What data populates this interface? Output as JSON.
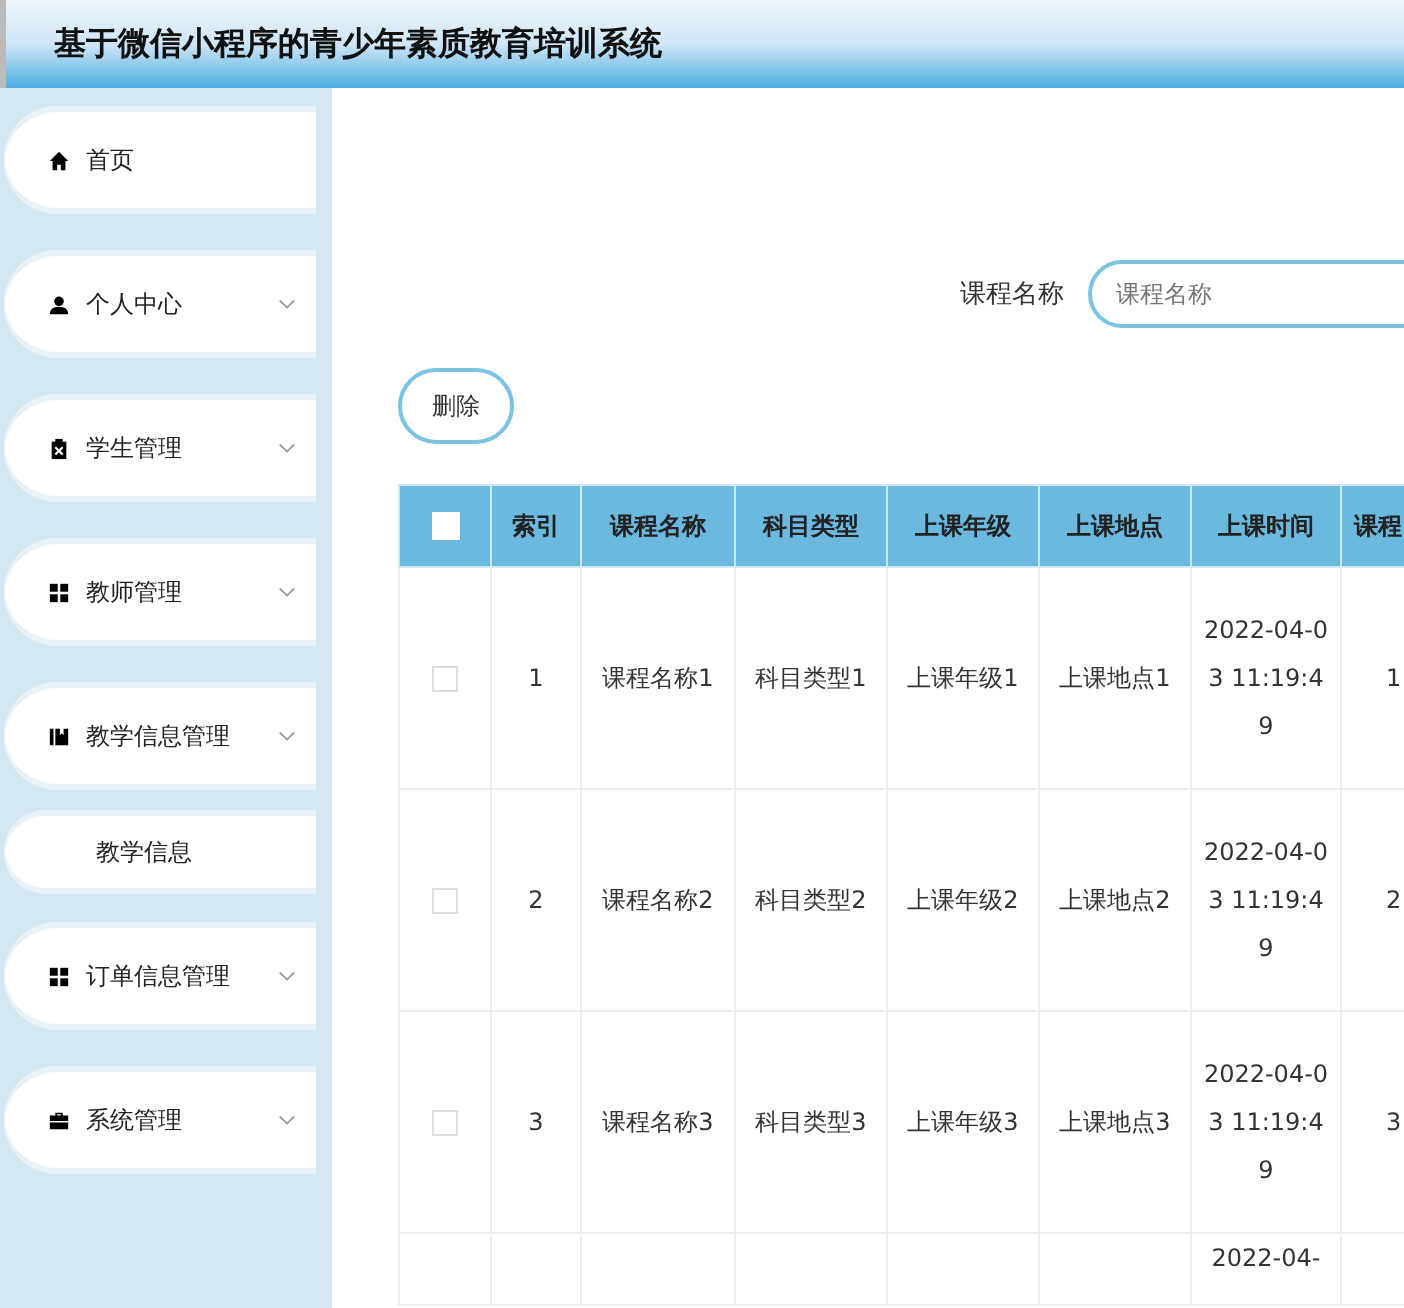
{
  "header": {
    "title": "基于微信小程序的青少年素质教育培训系统"
  },
  "sidebar": {
    "items": [
      {
        "label": "首页",
        "expandable": false,
        "kind": "item"
      },
      {
        "label": "个人中心",
        "expandable": true,
        "kind": "item"
      },
      {
        "label": "学生管理",
        "expandable": true,
        "kind": "item"
      },
      {
        "label": "教师管理",
        "expandable": true,
        "kind": "item"
      },
      {
        "label": "教学信息管理",
        "expandable": true,
        "kind": "item"
      },
      {
        "label": "教学信息",
        "kind": "subitem"
      },
      {
        "label": "订单信息管理",
        "expandable": true,
        "kind": "item"
      },
      {
        "label": "系统管理",
        "expandable": true,
        "kind": "item"
      }
    ]
  },
  "search": {
    "label": "课程名称",
    "placeholder": "课程名称"
  },
  "delete_button": "删除",
  "table": {
    "select_all": false,
    "columns": [
      "索引",
      "课程名称",
      "科目类型",
      "上课年级",
      "上课地点",
      "上课时间",
      "课程"
    ],
    "rows": [
      {
        "checked": false,
        "cells": [
          "1",
          "课程名称1",
          "科目类型1",
          "上课年级1",
          "上课地点1",
          "2022-04-03 11:19:49",
          "1"
        ]
      },
      {
        "checked": false,
        "cells": [
          "2",
          "课程名称2",
          "科目类型2",
          "上课年级2",
          "上课地点2",
          "2022-04-03 11:19:49",
          "2"
        ]
      },
      {
        "checked": false,
        "cells": [
          "3",
          "课程名称3",
          "科目类型3",
          "上课年级3",
          "上课地点3",
          "2022-04-03 11:19:49",
          "3"
        ]
      }
    ],
    "partial_row": {
      "time": "2022-04-"
    }
  }
}
